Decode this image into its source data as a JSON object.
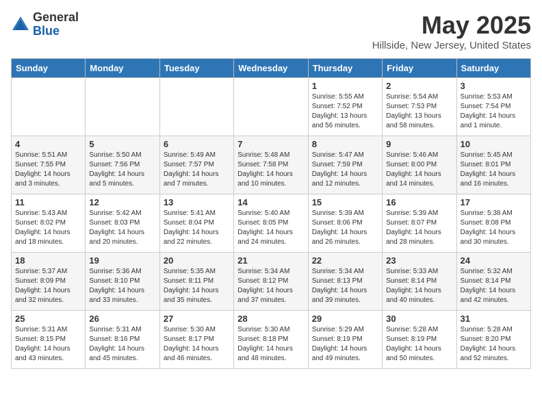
{
  "header": {
    "logo_general": "General",
    "logo_blue": "Blue",
    "title": "May 2025",
    "subtitle": "Hillside, New Jersey, United States"
  },
  "days_of_week": [
    "Sunday",
    "Monday",
    "Tuesday",
    "Wednesday",
    "Thursday",
    "Friday",
    "Saturday"
  ],
  "weeks": [
    [
      {
        "day": "",
        "content": ""
      },
      {
        "day": "",
        "content": ""
      },
      {
        "day": "",
        "content": ""
      },
      {
        "day": "",
        "content": ""
      },
      {
        "day": "1",
        "content": "Sunrise: 5:55 AM\nSunset: 7:52 PM\nDaylight: 13 hours\nand 56 minutes."
      },
      {
        "day": "2",
        "content": "Sunrise: 5:54 AM\nSunset: 7:53 PM\nDaylight: 13 hours\nand 58 minutes."
      },
      {
        "day": "3",
        "content": "Sunrise: 5:53 AM\nSunset: 7:54 PM\nDaylight: 14 hours\nand 1 minute."
      }
    ],
    [
      {
        "day": "4",
        "content": "Sunrise: 5:51 AM\nSunset: 7:55 PM\nDaylight: 14 hours\nand 3 minutes."
      },
      {
        "day": "5",
        "content": "Sunrise: 5:50 AM\nSunset: 7:56 PM\nDaylight: 14 hours\nand 5 minutes."
      },
      {
        "day": "6",
        "content": "Sunrise: 5:49 AM\nSunset: 7:57 PM\nDaylight: 14 hours\nand 7 minutes."
      },
      {
        "day": "7",
        "content": "Sunrise: 5:48 AM\nSunset: 7:58 PM\nDaylight: 14 hours\nand 10 minutes."
      },
      {
        "day": "8",
        "content": "Sunrise: 5:47 AM\nSunset: 7:59 PM\nDaylight: 14 hours\nand 12 minutes."
      },
      {
        "day": "9",
        "content": "Sunrise: 5:46 AM\nSunset: 8:00 PM\nDaylight: 14 hours\nand 14 minutes."
      },
      {
        "day": "10",
        "content": "Sunrise: 5:45 AM\nSunset: 8:01 PM\nDaylight: 14 hours\nand 16 minutes."
      }
    ],
    [
      {
        "day": "11",
        "content": "Sunrise: 5:43 AM\nSunset: 8:02 PM\nDaylight: 14 hours\nand 18 minutes."
      },
      {
        "day": "12",
        "content": "Sunrise: 5:42 AM\nSunset: 8:03 PM\nDaylight: 14 hours\nand 20 minutes."
      },
      {
        "day": "13",
        "content": "Sunrise: 5:41 AM\nSunset: 8:04 PM\nDaylight: 14 hours\nand 22 minutes."
      },
      {
        "day": "14",
        "content": "Sunrise: 5:40 AM\nSunset: 8:05 PM\nDaylight: 14 hours\nand 24 minutes."
      },
      {
        "day": "15",
        "content": "Sunrise: 5:39 AM\nSunset: 8:06 PM\nDaylight: 14 hours\nand 26 minutes."
      },
      {
        "day": "16",
        "content": "Sunrise: 5:39 AM\nSunset: 8:07 PM\nDaylight: 14 hours\nand 28 minutes."
      },
      {
        "day": "17",
        "content": "Sunrise: 5:38 AM\nSunset: 8:08 PM\nDaylight: 14 hours\nand 30 minutes."
      }
    ],
    [
      {
        "day": "18",
        "content": "Sunrise: 5:37 AM\nSunset: 8:09 PM\nDaylight: 14 hours\nand 32 minutes."
      },
      {
        "day": "19",
        "content": "Sunrise: 5:36 AM\nSunset: 8:10 PM\nDaylight: 14 hours\nand 33 minutes."
      },
      {
        "day": "20",
        "content": "Sunrise: 5:35 AM\nSunset: 8:11 PM\nDaylight: 14 hours\nand 35 minutes."
      },
      {
        "day": "21",
        "content": "Sunrise: 5:34 AM\nSunset: 8:12 PM\nDaylight: 14 hours\nand 37 minutes."
      },
      {
        "day": "22",
        "content": "Sunrise: 5:34 AM\nSunset: 8:13 PM\nDaylight: 14 hours\nand 39 minutes."
      },
      {
        "day": "23",
        "content": "Sunrise: 5:33 AM\nSunset: 8:14 PM\nDaylight: 14 hours\nand 40 minutes."
      },
      {
        "day": "24",
        "content": "Sunrise: 5:32 AM\nSunset: 8:14 PM\nDaylight: 14 hours\nand 42 minutes."
      }
    ],
    [
      {
        "day": "25",
        "content": "Sunrise: 5:31 AM\nSunset: 8:15 PM\nDaylight: 14 hours\nand 43 minutes."
      },
      {
        "day": "26",
        "content": "Sunrise: 5:31 AM\nSunset: 8:16 PM\nDaylight: 14 hours\nand 45 minutes."
      },
      {
        "day": "27",
        "content": "Sunrise: 5:30 AM\nSunset: 8:17 PM\nDaylight: 14 hours\nand 46 minutes."
      },
      {
        "day": "28",
        "content": "Sunrise: 5:30 AM\nSunset: 8:18 PM\nDaylight: 14 hours\nand 48 minutes."
      },
      {
        "day": "29",
        "content": "Sunrise: 5:29 AM\nSunset: 8:19 PM\nDaylight: 14 hours\nand 49 minutes."
      },
      {
        "day": "30",
        "content": "Sunrise: 5:28 AM\nSunset: 8:19 PM\nDaylight: 14 hours\nand 50 minutes."
      },
      {
        "day": "31",
        "content": "Sunrise: 5:28 AM\nSunset: 8:20 PM\nDaylight: 14 hours\nand 52 minutes."
      }
    ]
  ]
}
